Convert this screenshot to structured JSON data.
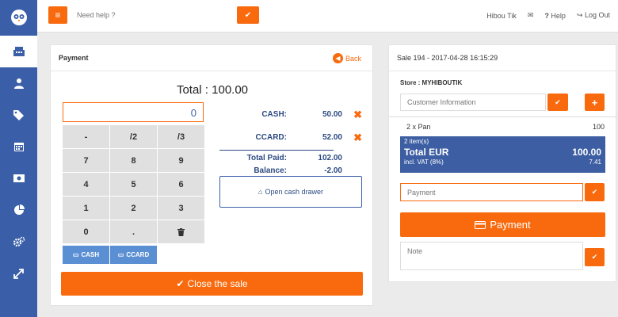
{
  "topbar": {
    "help_placeholder": "Need help ?",
    "user": "Hibou Tik",
    "help_link": "Help",
    "logout": "Log Out"
  },
  "payment_panel": {
    "title": "Payment",
    "back": "Back",
    "total": "Total : 100.00",
    "amount_value": "0",
    "keys": [
      [
        "-",
        "/2",
        "/3"
      ],
      [
        "7",
        "8",
        "9"
      ],
      [
        "4",
        "5",
        "6"
      ],
      [
        "1",
        "2",
        "3"
      ],
      [
        "0",
        ".",
        ""
      ]
    ],
    "cash_label": "CASH",
    "ccard_label": "CCARD",
    "payments": [
      {
        "label": "CASH:",
        "value": "50.00"
      },
      {
        "label": "CCARD:",
        "value": "52.00"
      }
    ],
    "total_paid_label": "Total Paid:",
    "total_paid": "102.00",
    "balance_label": "Balance:",
    "balance": "-2.00",
    "open_drawer": "Open cash drawer",
    "close_sale": "Close the sale"
  },
  "sale_panel": {
    "title": "Sale 194 - 2017-04-28 16:15:29",
    "store": "Store : MYHIBOUTIK",
    "customer_placeholder": "Customer Information",
    "items": [
      {
        "name": "2 x Pan",
        "price": "100"
      }
    ],
    "item_count": "2 item(s)",
    "total_label": "Total EUR",
    "total_value": "100.00",
    "vat_label": "incl. VAT (8%)",
    "vat_value": "7.41",
    "payment_placeholder": "Payment",
    "payment_button": "Payment",
    "note_placeholder": "Note"
  },
  "colors": {
    "accent": "#f96a0e",
    "brand": "#3a5fa8"
  }
}
